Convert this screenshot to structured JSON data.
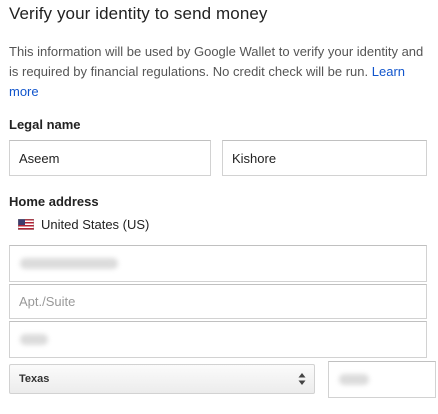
{
  "header": {
    "title": "Verify your identity to send money"
  },
  "info": {
    "text": "This information will be used by Google Wallet to verify your identity and is required by financial regulations. No credit check will be run.",
    "learn_more": "Learn more"
  },
  "legal_name": {
    "label": "Legal name",
    "first_name": "Aseem",
    "last_name": "Kishore"
  },
  "home_address": {
    "label": "Home address",
    "country": "United States (US)",
    "country_icon": "us-flag-icon",
    "street_blurred": true,
    "apt_placeholder": "Apt./Suite",
    "city_blurred": true,
    "state": "Texas",
    "zip_blurred": true
  },
  "colors": {
    "link": "#1155cc",
    "border": "#d2d2d2",
    "text_secondary": "#555555"
  }
}
